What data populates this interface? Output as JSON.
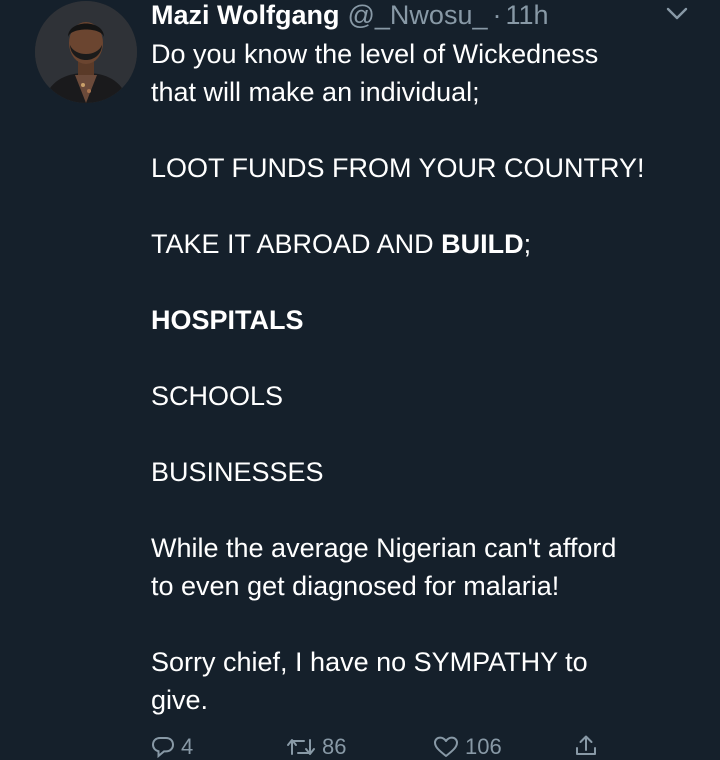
{
  "tweet": {
    "author_name": "Mazi Wolfgang",
    "handle": "@_Nwosu_",
    "separator": "·",
    "time": "11h",
    "paragraphs": [
      {
        "lines": [
          "Do you know the level of Wickedness",
          "that will make an individual;"
        ]
      },
      {
        "text": "LOOT FUNDS FROM YOUR COUNTRY!"
      },
      {
        "prefix": "TAKE IT ABROAD AND ",
        "bold": "BUILD",
        "suffix": ";"
      },
      {
        "bold_text": "HOSPITALS"
      },
      {
        "text": "SCHOOLS"
      },
      {
        "text": "BUSINESSES"
      },
      {
        "lines": [
          "While the average Nigerian can't afford",
          "to even get diagnosed for malaria!"
        ]
      },
      {
        "lines": [
          "Sorry chief, I have no SYMPATHY to",
          "give."
        ]
      }
    ],
    "actions": {
      "reply_count": "4",
      "retweet_count": "86",
      "like_count": "106"
    }
  },
  "icons": {
    "more": "chevron-down-icon",
    "reply": "reply-icon",
    "retweet": "retweet-icon",
    "like": "heart-icon",
    "share": "share-icon"
  },
  "colors": {
    "background": "#15202b",
    "text": "#ffffff",
    "secondary": "#8899a6"
  }
}
